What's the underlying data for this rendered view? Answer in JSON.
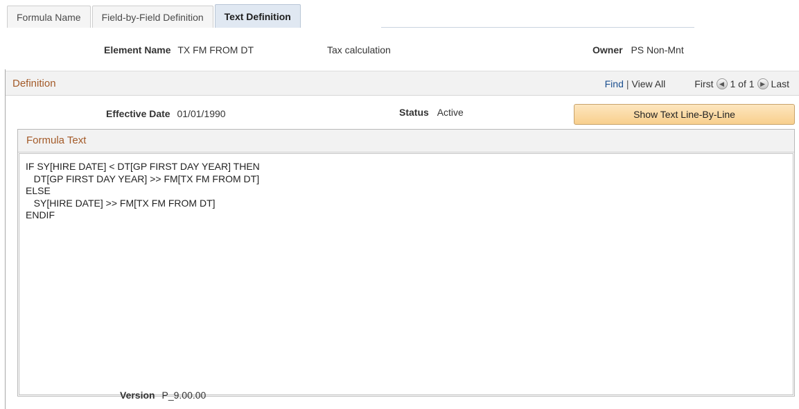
{
  "tabs": [
    {
      "label": "Formula Name",
      "active": false
    },
    {
      "label": "Field-by-Field Definition",
      "active": false
    },
    {
      "label": "Text Definition",
      "active": true
    }
  ],
  "header": {
    "element_name_label": "Element Name",
    "element_name_value": "TX FM FROM DT",
    "description": "Tax calculation",
    "owner_label": "Owner",
    "owner_value": "PS Non-Mnt"
  },
  "definition": {
    "title": "Definition",
    "find_link": "Find",
    "separator": "|",
    "view_all_link": "View All",
    "first_label": "First",
    "pager_text": "1 of 1",
    "last_label": "Last",
    "effective_date_label": "Effective Date",
    "effective_date_value": "01/01/1990",
    "status_label": "Status",
    "status_value": "Active",
    "show_text_button": "Show Text Line-By-Line"
  },
  "formula_text": {
    "title": "Formula Text",
    "body": "IF SY[HIRE DATE] < DT[GP FIRST DAY YEAR] THEN\n   DT[GP FIRST DAY YEAR] >> FM[TX FM FROM DT]\nELSE\n   SY[HIRE DATE] >> FM[TX FM FROM DT]\nENDIF"
  },
  "footer": {
    "version_label": "Version",
    "version_value": "P_9.00.00"
  },
  "colors": {
    "section_title": "#a35a28",
    "link": "#1b4f8f",
    "button_bg": "#f8cf8d"
  }
}
